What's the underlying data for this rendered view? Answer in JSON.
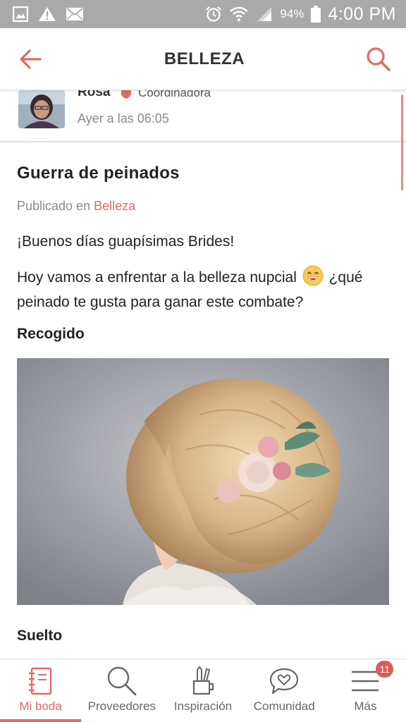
{
  "status_bar": {
    "battery_percent": "94%",
    "time": "4:00 PM",
    "icons": [
      "gallery-icon",
      "warning-icon",
      "mail-icon",
      "alarm-icon",
      "wifi-icon",
      "signal-icon",
      "battery-icon"
    ]
  },
  "header": {
    "title": "BELLEZA",
    "back_icon": "back-arrow-icon",
    "search_icon": "search-icon",
    "accent_color": "#e06a66"
  },
  "author": {
    "name": "Rosa",
    "role": "Coordinadora",
    "time": "Ayer a las 06:05"
  },
  "post": {
    "title": "Guerra de peinados",
    "published_prefix": "Publicado en",
    "category": "Belleza",
    "paragraph1": "¡Buenos días guapísimas Brides!",
    "paragraph2_before": "Hoy vamos a enfrentar a la belleza nupcial",
    "paragraph2_after": "¿qué peinado te gusta para ganar este combate?",
    "section1": "Recogido",
    "section2": "Suelto"
  },
  "bottom_nav": {
    "items": [
      {
        "label": "Mi boda",
        "icon": "notebook-icon",
        "active": true
      },
      {
        "label": "Proveedores",
        "icon": "search-icon",
        "active": false
      },
      {
        "label": "Inspiración",
        "icon": "pencil-cup-icon",
        "active": false
      },
      {
        "label": "Comunidad",
        "icon": "chat-heart-icon",
        "active": false
      },
      {
        "label": "Más",
        "icon": "menu-icon",
        "active": false,
        "badge": "11"
      }
    ]
  }
}
